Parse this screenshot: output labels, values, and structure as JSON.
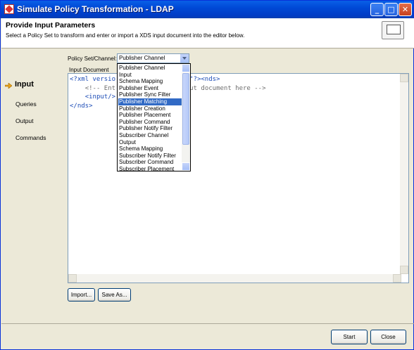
{
  "window": {
    "title": "Simulate Policy Transformation - LDAP"
  },
  "header": {
    "title": "Provide Input Parameters",
    "subtitle": "Select a Policy Set to transform and enter or import a XDS input document into the editor below."
  },
  "nav": {
    "items": [
      {
        "label": "Input",
        "active": true
      },
      {
        "label": "Queries"
      },
      {
        "label": "Output"
      },
      {
        "label": "Commands"
      }
    ]
  },
  "form": {
    "policy_label": "Policy Set/Channel:",
    "policy_value": "Publisher Channel",
    "input_doc_label": "Input Document"
  },
  "editor": {
    "line1_a": "<?xml versio",
    "line1_b": "UTF-8\"?><nds>",
    "line2_a": "<!-- Ent",
    "line2_b": "S input document here -->",
    "line3": "<input/>",
    "line4": "</nds>"
  },
  "dropdown": {
    "options": [
      "Publisher Channel",
      "Input",
      "Schema Mapping",
      "Publisher Event",
      "Publisher Sync Filter",
      "Publisher Matching",
      "Publisher Creation",
      "Publisher Placement",
      "Publisher Command",
      "Publisher Notify Filter",
      "Subscriber Channel",
      "Output",
      "Schema Mapping",
      "Subscriber Notify Filter",
      "Subscriber Command",
      "Subscriber Placement"
    ],
    "highlighted": "Publisher Matching"
  },
  "buttons": {
    "import": "Import...",
    "save_as": "Save As...",
    "start": "Start",
    "close": "Close"
  },
  "colors": {
    "selection": "#316ac5",
    "title_bar": "#0049d6"
  }
}
